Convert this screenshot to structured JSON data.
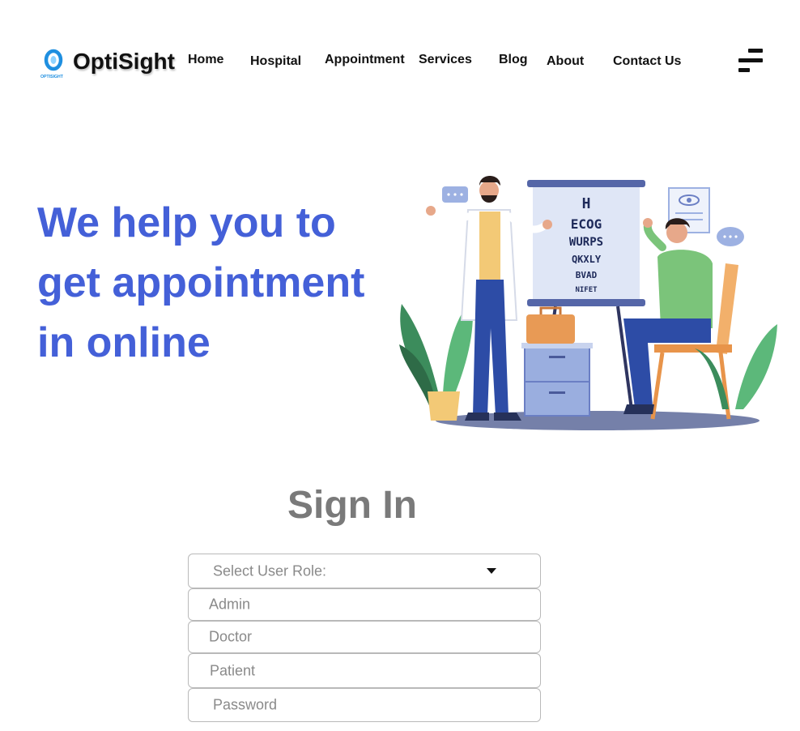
{
  "brand": {
    "name": "OptiSight",
    "logo_subtext": "OPTISIGHT",
    "color": "#1f8fe0",
    "icon": "eye-logo-icon"
  },
  "nav": {
    "links": [
      "Home",
      "Hospital",
      "Appointment",
      "Services",
      "Blog",
      "About",
      "Contact Us"
    ],
    "menu_icon": "hamburger-menu-icon"
  },
  "hero": {
    "headline": "We  help you  to\nget appointment\nin online",
    "headline_color": "#4460d8",
    "chart_letters": [
      "H",
      "ECOG",
      "WURPS",
      "QKXLY",
      "BVAD",
      "NIFET"
    ]
  },
  "signin": {
    "title": "Sign In",
    "role_select": {
      "placeholder": "Select  User Role:",
      "options": [
        "Admin",
        "Doctor",
        "Patient"
      ]
    },
    "password_placeholder": "Password"
  }
}
